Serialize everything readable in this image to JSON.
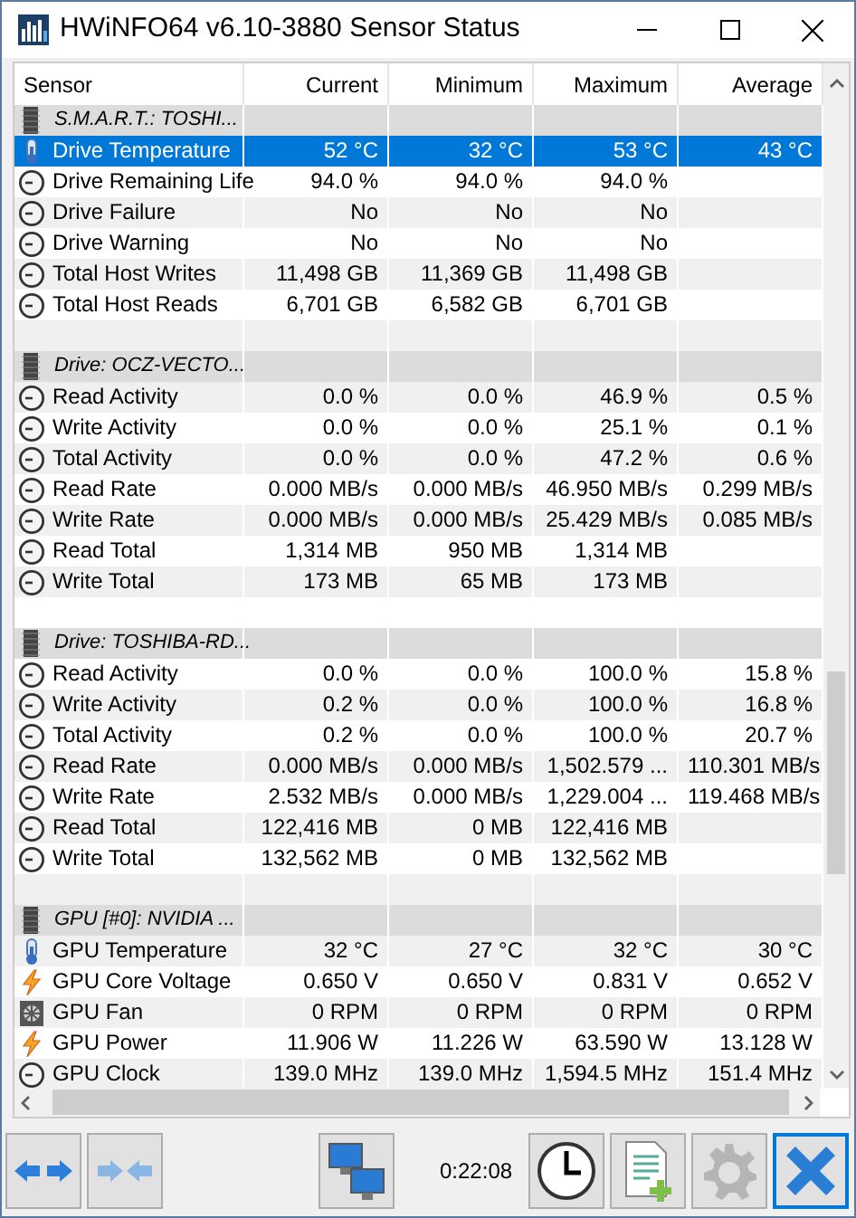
{
  "window": {
    "title": "HWiNFO64 v6.10-3880 Sensor Status"
  },
  "columns": [
    "Sensor",
    "Current",
    "Minimum",
    "Maximum",
    "Average"
  ],
  "groups": [
    {
      "name": "S.M.A.R.T.: TOSHI...",
      "rows": [
        {
          "kind": "temperature",
          "selected": true,
          "label": "Drive Temperature",
          "values": [
            "52 °C",
            "32 °C",
            "53 °C",
            "43 °C"
          ]
        },
        {
          "kind": "gauge",
          "selected": false,
          "label": "Drive Remaining Life",
          "values": [
            "94.0 %",
            "94.0 %",
            "94.0 %"
          ]
        },
        {
          "kind": "gauge",
          "selected": false,
          "label": "Drive Failure",
          "values": [
            "No",
            "No",
            "No"
          ]
        },
        {
          "kind": "gauge",
          "selected": false,
          "label": "Drive Warning",
          "values": [
            "No",
            "No",
            "No"
          ]
        },
        {
          "kind": "gauge",
          "selected": false,
          "label": "Total Host Writes",
          "values": [
            "11,498 GB",
            "11,369 GB",
            "11,498 GB"
          ]
        },
        {
          "kind": "gauge",
          "selected": false,
          "label": "Total Host Reads",
          "values": [
            "6,701 GB",
            "6,582 GB",
            "6,701 GB"
          ]
        }
      ]
    },
    {
      "name": "Drive: OCZ-VECTO...",
      "rows": [
        {
          "kind": "gauge",
          "selected": false,
          "label": "Read Activity",
          "values": [
            "0.0 %",
            "0.0 %",
            "46.9 %",
            "0.5 %"
          ]
        },
        {
          "kind": "gauge",
          "selected": false,
          "label": "Write Activity",
          "values": [
            "0.0 %",
            "0.0 %",
            "25.1 %",
            "0.1 %"
          ]
        },
        {
          "kind": "gauge",
          "selected": false,
          "label": "Total Activity",
          "values": [
            "0.0 %",
            "0.0 %",
            "47.2 %",
            "0.6 %"
          ]
        },
        {
          "kind": "gauge",
          "selected": false,
          "label": "Read Rate",
          "values": [
            "0.000 MB/s",
            "0.000 MB/s",
            "46.950 MB/s",
            "0.299 MB/s"
          ]
        },
        {
          "kind": "gauge",
          "selected": false,
          "label": "Write Rate",
          "values": [
            "0.000 MB/s",
            "0.000 MB/s",
            "25.429 MB/s",
            "0.085 MB/s"
          ]
        },
        {
          "kind": "gauge",
          "selected": false,
          "label": "Read Total",
          "values": [
            "1,314 MB",
            "950 MB",
            "1,314 MB"
          ]
        },
        {
          "kind": "gauge",
          "selected": false,
          "label": "Write Total",
          "values": [
            "173 MB",
            "65 MB",
            "173 MB"
          ]
        }
      ]
    },
    {
      "name": "Drive: TOSHIBA-RD...",
      "rows": [
        {
          "kind": "gauge",
          "selected": false,
          "label": "Read Activity",
          "values": [
            "0.0 %",
            "0.0 %",
            "100.0 %",
            "15.8 %"
          ]
        },
        {
          "kind": "gauge",
          "selected": false,
          "label": "Write Activity",
          "values": [
            "0.2 %",
            "0.0 %",
            "100.0 %",
            "16.8 %"
          ]
        },
        {
          "kind": "gauge",
          "selected": false,
          "label": "Total Activity",
          "values": [
            "0.2 %",
            "0.0 %",
            "100.0 %",
            "20.7 %"
          ]
        },
        {
          "kind": "gauge",
          "selected": false,
          "label": "Read Rate",
          "values": [
            "0.000 MB/s",
            "0.000 MB/s",
            "1,502.579 ...",
            "110.301 MB/s"
          ]
        },
        {
          "kind": "gauge",
          "selected": false,
          "label": "Write Rate",
          "values": [
            "2.532 MB/s",
            "0.000 MB/s",
            "1,229.004 ...",
            "119.468 MB/s"
          ]
        },
        {
          "kind": "gauge",
          "selected": false,
          "label": "Read Total",
          "values": [
            "122,416 MB",
            "0 MB",
            "122,416 MB"
          ]
        },
        {
          "kind": "gauge",
          "selected": false,
          "label": "Write Total",
          "values": [
            "132,562 MB",
            "0 MB",
            "132,562 MB"
          ]
        }
      ]
    },
    {
      "name": "GPU [#0]: NVIDIA ...",
      "rows": [
        {
          "kind": "temperature",
          "selected": false,
          "label": "GPU Temperature",
          "values": [
            "32 °C",
            "27 °C",
            "32 °C",
            "30 °C"
          ]
        },
        {
          "kind": "power",
          "selected": false,
          "label": "GPU Core Voltage",
          "values": [
            "0.650 V",
            "0.650 V",
            "0.831 V",
            "0.652 V"
          ]
        },
        {
          "kind": "fan",
          "selected": false,
          "label": "GPU Fan",
          "values": [
            "0 RPM",
            "0 RPM",
            "0 RPM",
            "0 RPM"
          ]
        },
        {
          "kind": "power",
          "selected": false,
          "label": "GPU Power",
          "values": [
            "11.906 W",
            "11.226 W",
            "63.590 W",
            "13.128 W"
          ]
        },
        {
          "kind": "gauge",
          "selected": false,
          "label": "GPU Clock",
          "values": [
            "139.0 MHz",
            "139.0 MHz",
            "1,594.5 MHz",
            "151.4 MHz"
          ]
        }
      ]
    }
  ],
  "toolbar": {
    "elapsed": "0:22:08"
  }
}
